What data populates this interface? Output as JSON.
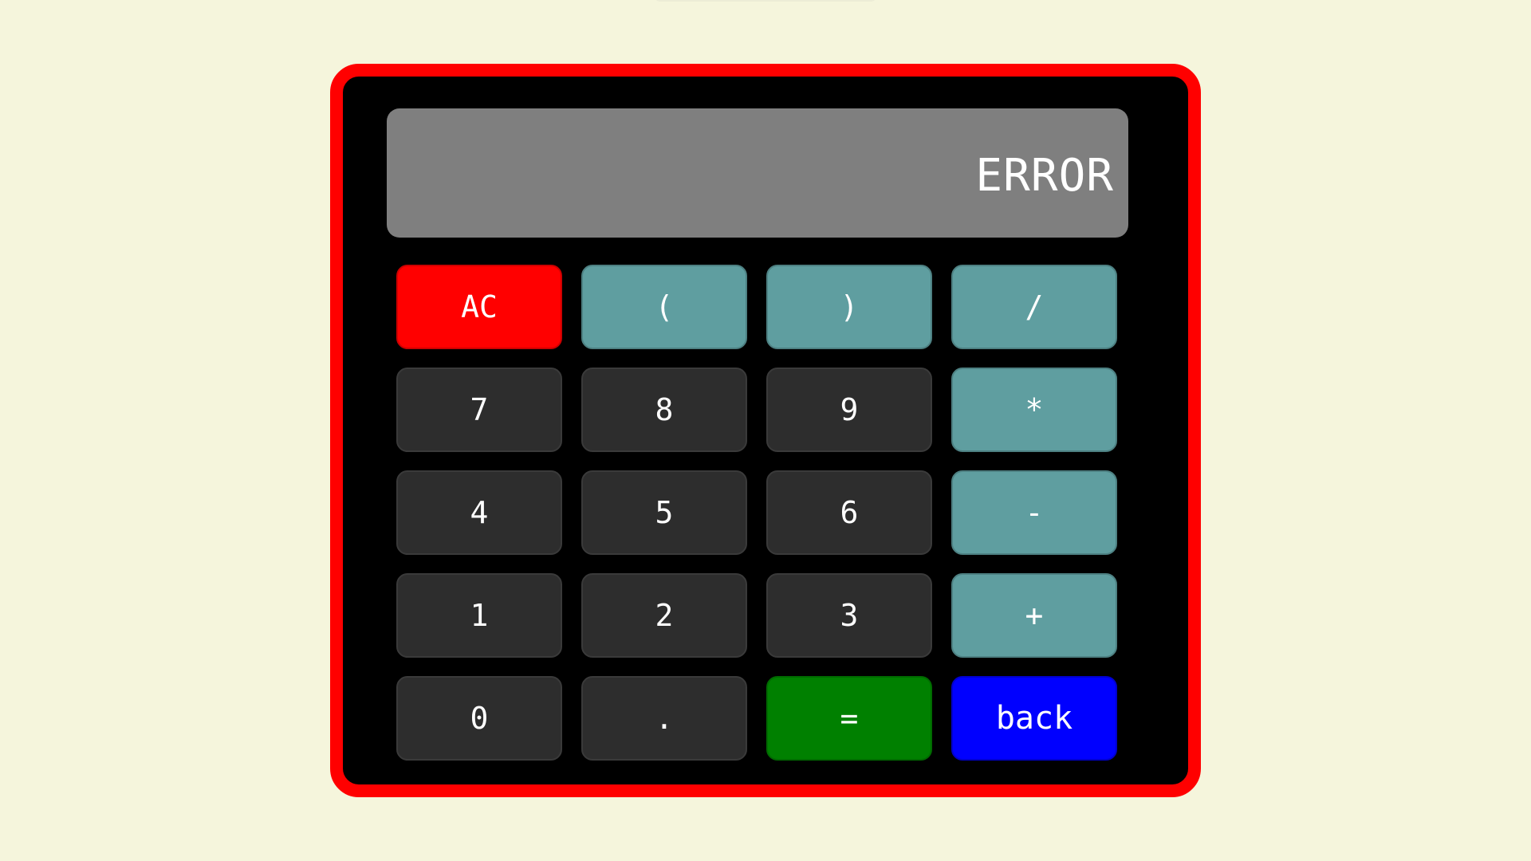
{
  "display": {
    "value": "ERROR"
  },
  "keys": [
    {
      "label": "AC",
      "kind": "clear",
      "name": "ac-button"
    },
    {
      "label": "(",
      "kind": "op",
      "name": "open-paren-button"
    },
    {
      "label": ")",
      "kind": "op",
      "name": "close-paren-button"
    },
    {
      "label": "/",
      "kind": "op",
      "name": "divide-button"
    },
    {
      "label": "7",
      "kind": "num",
      "name": "digit-7-button"
    },
    {
      "label": "8",
      "kind": "num",
      "name": "digit-8-button"
    },
    {
      "label": "9",
      "kind": "num",
      "name": "digit-9-button"
    },
    {
      "label": "*",
      "kind": "op",
      "name": "multiply-button"
    },
    {
      "label": "4",
      "kind": "num",
      "name": "digit-4-button"
    },
    {
      "label": "5",
      "kind": "num",
      "name": "digit-5-button"
    },
    {
      "label": "6",
      "kind": "num",
      "name": "digit-6-button"
    },
    {
      "label": "-",
      "kind": "op",
      "name": "subtract-button"
    },
    {
      "label": "1",
      "kind": "num",
      "name": "digit-1-button"
    },
    {
      "label": "2",
      "kind": "num",
      "name": "digit-2-button"
    },
    {
      "label": "3",
      "kind": "num",
      "name": "digit-3-button"
    },
    {
      "label": "+",
      "kind": "op",
      "name": "add-button"
    },
    {
      "label": "0",
      "kind": "num",
      "name": "digit-0-button"
    },
    {
      "label": ".",
      "kind": "num",
      "name": "decimal-point-button"
    },
    {
      "label": "=",
      "kind": "equals",
      "name": "equals-button"
    },
    {
      "label": "back",
      "kind": "back",
      "name": "backspace-button"
    }
  ],
  "colors": {
    "page_background": "#f5f5dc",
    "frame_border": "#ff0000",
    "frame_background": "#000000",
    "display_background": "#7f7f7f",
    "number_key": "#2d2d2d",
    "operator_key": "#5f9ea0",
    "clear_key": "#ff0000",
    "equals_key": "#008000",
    "back_key": "#0000ff"
  }
}
